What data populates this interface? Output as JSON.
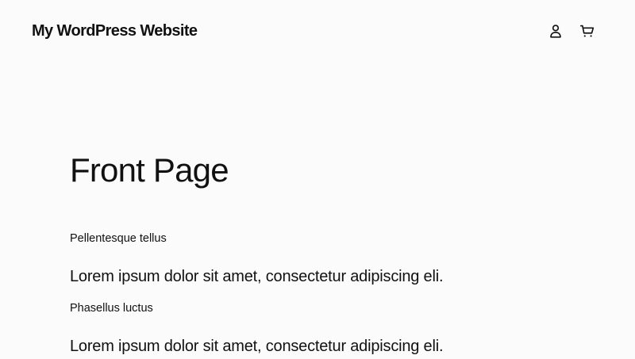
{
  "header": {
    "site_title": "My WordPress Website",
    "account_icon": "account-icon",
    "cart_icon": "cart-icon"
  },
  "main": {
    "title": "Front Page",
    "paragraphs": [
      "Pellentesque tellus",
      "Lorem ipsum dolor sit amet, consectetur adipiscing eli.",
      "Phasellus luctus",
      "Lorem ipsum dolor sit amet, consectetur adipiscing eli."
    ]
  },
  "colors": {
    "background": "#fbfbfb",
    "text": "#111111"
  }
}
